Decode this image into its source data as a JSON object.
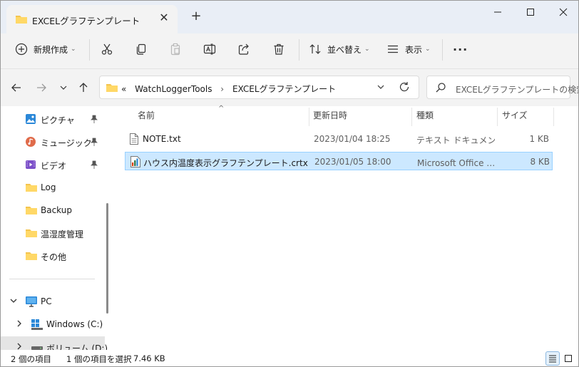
{
  "window": {
    "tab_title": "EXCELグラフテンプレート"
  },
  "toolbar": {
    "new_label": "新規作成",
    "sort_label": "並べ替え",
    "view_label": "表示",
    "more_label": "···"
  },
  "address": {
    "overflow": "«",
    "crumb1": "WatchLoggerTools",
    "crumb2": "EXCELグラフテンプレート",
    "search_placeholder": "EXCELグラフテンプレートの検索"
  },
  "nav": {
    "quick": [
      {
        "label": "ピクチャ",
        "icon": "pictures-icon"
      },
      {
        "label": "ミュージック",
        "icon": "music-icon"
      },
      {
        "label": "ビデオ",
        "icon": "videos-icon"
      },
      {
        "label": "Log",
        "icon": "folder-icon"
      },
      {
        "label": "Backup",
        "icon": "folder-icon"
      },
      {
        "label": "温湿度管理",
        "icon": "folder-icon"
      },
      {
        "label": "その他",
        "icon": "folder-icon"
      }
    ],
    "pc_label": "PC",
    "drives": [
      {
        "label": "Windows (C:)"
      },
      {
        "label": "ボリューム (D:)"
      }
    ]
  },
  "columns": {
    "name": "名前",
    "date": "更新日時",
    "type": "種類",
    "size": "サイズ"
  },
  "files": [
    {
      "name": "NOTE.txt",
      "date": "2023/01/04 18:25",
      "type": "テキスト ドキュメント",
      "size": "1 KB",
      "selected": false,
      "icon": "text-file-icon"
    },
    {
      "name": "ハウス内温度表示グラフテンプレート.crtx",
      "date": "2023/01/05 18:00",
      "type": "Microsoft Office グラフテンプレート",
      "size": "8 KB",
      "selected": true,
      "icon": "chart-template-icon"
    }
  ],
  "status": {
    "count": "2 個の項目",
    "selected": "1 個の項目を選択",
    "size": "7.46 KB"
  },
  "colors": {
    "accent": "#0067c0",
    "selection": "#cce8ff",
    "folder": "#f4c44e"
  }
}
